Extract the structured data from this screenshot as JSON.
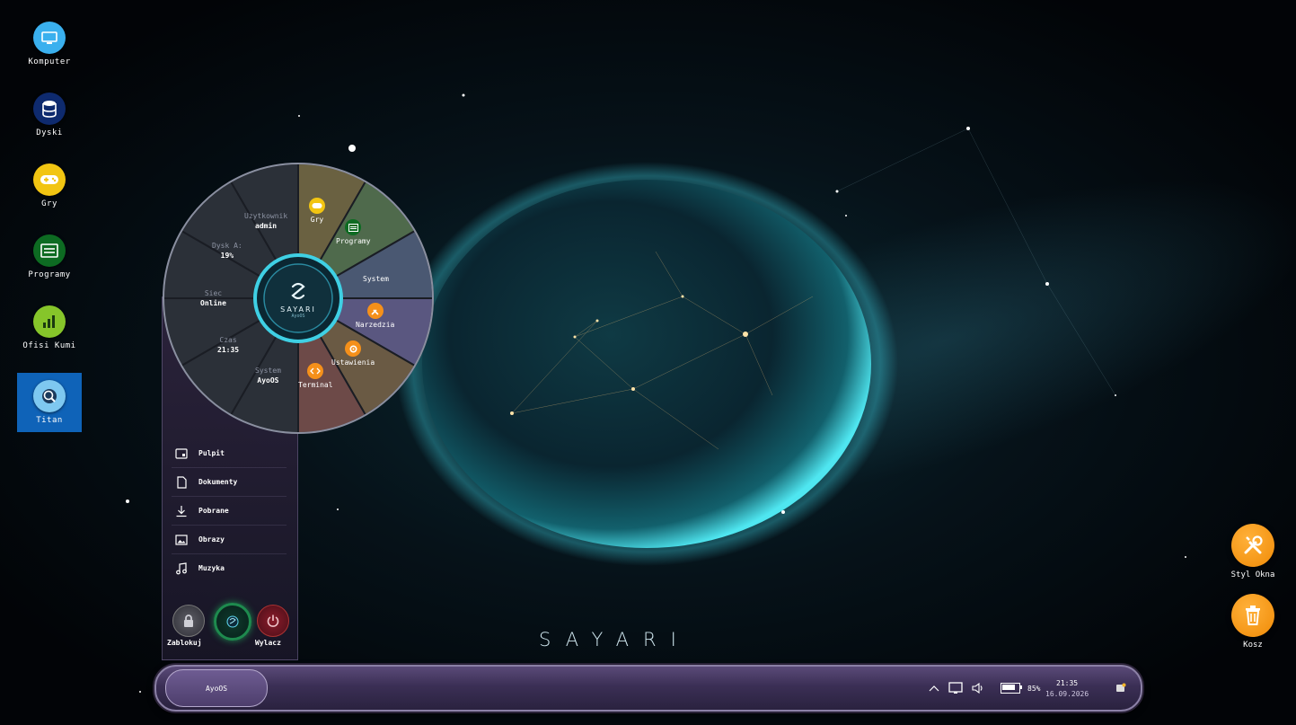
{
  "desktop_icons": [
    {
      "label": "Komputer",
      "icon": "computer-icon",
      "color": "#3ab0ee"
    },
    {
      "label": "Dyski",
      "icon": "database-icon",
      "color": "#0e2a6e"
    },
    {
      "label": "Gry",
      "icon": "gamepad-icon",
      "color": "#f2c512"
    },
    {
      "label": "Programy",
      "icon": "program-list-icon",
      "color": "#0d6b22"
    },
    {
      "label": "Ofisi Kumi",
      "icon": "office-icon",
      "color": "#86c52a"
    },
    {
      "label": "Titan",
      "icon": "titan-icon",
      "color": "#1b5fa8"
    }
  ],
  "right_icons": [
    {
      "label": "Styl Okna",
      "icon": "tools-icon"
    },
    {
      "label": "Kosz",
      "icon": "trash-icon"
    }
  ],
  "wallpaper": {
    "brand_text": "SAYARI"
  },
  "start_menu": {
    "center": {
      "title": "SAYARI",
      "subtitle": "AyoOS"
    },
    "info_wedges": [
      {
        "label": "Uzytkownik",
        "value": "admin"
      },
      {
        "label": "Dysk A:",
        "value": "19%"
      },
      {
        "label": "Siec",
        "value": "Online"
      },
      {
        "label": "Czas",
        "value": "21:35"
      },
      {
        "label": "System",
        "value": "AyoOS"
      }
    ],
    "app_wedges": [
      {
        "label": "Gry",
        "icon": "gamepad-icon",
        "color": "#f2c512"
      },
      {
        "label": "Programy",
        "icon": "program-list-icon",
        "color": "#0d6b22"
      },
      {
        "label": "System",
        "icon": ""
      },
      {
        "label": "Narzedzia",
        "icon": "tools-icon",
        "color": "#f5901a"
      },
      {
        "label": "Ustawienia",
        "icon": "gear-icon",
        "color": "#f5901a"
      },
      {
        "label": "Terminal",
        "icon": "code-icon",
        "color": "#f5901a"
      }
    ],
    "folders": [
      {
        "label": "Pulpit",
        "icon": "desktop-icon"
      },
      {
        "label": "Dokumenty",
        "icon": "document-icon"
      },
      {
        "label": "Pobrane",
        "icon": "download-icon"
      },
      {
        "label": "Obrazy",
        "icon": "image-icon"
      },
      {
        "label": "Muzyka",
        "icon": "music-icon"
      }
    ],
    "power": {
      "lock_label": "Zablokuj",
      "shutdown_label": "Wylacz"
    }
  },
  "taskbar": {
    "start_label": "AyoOS",
    "battery_percent": "85%",
    "battery_level": 0.85,
    "time": "21:35",
    "date": "16.09.2026"
  }
}
